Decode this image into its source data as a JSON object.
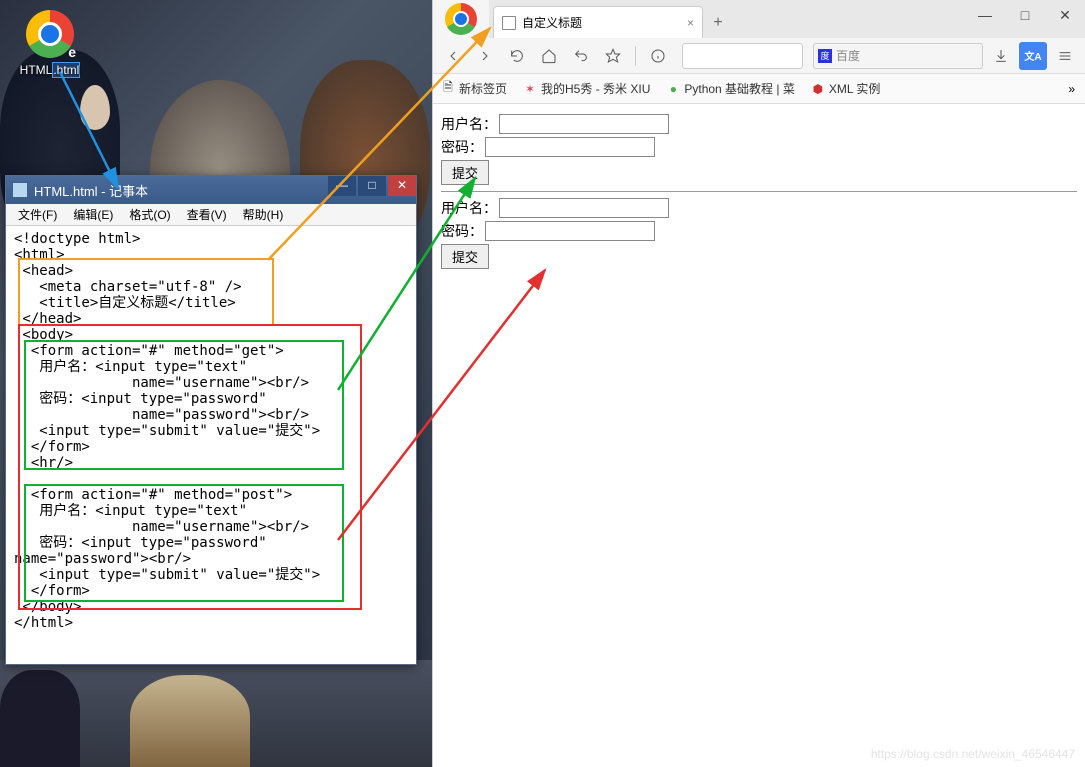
{
  "desktop": {
    "icon_label": "HTML.html",
    "icon_label_prefix": "HTML",
    "icon_label_suffix": ".html"
  },
  "notepad": {
    "title": "HTML.html - 记事本",
    "menu": [
      "文件(F)",
      "编辑(E)",
      "格式(O)",
      "查看(V)",
      "帮助(H)"
    ],
    "win_min": "—",
    "win_max": "□",
    "win_close": "✕",
    "code": "<!doctype html>\n<html>\n <head>\n   <meta charset=\"utf-8\" />\n   <title>自定义标题</title>\n </head>\n <body>\n  <form action=\"#\" method=\"get\">\n   用户名：<input type=\"text\"\n              name=\"username\"><br/>\n   密码：<input type=\"password\"\n              name=\"password\"><br/>\n   <input type=\"submit\" value=\"提交\">\n  </form>\n  <hr/>\n\n  <form action=\"#\" method=\"post\">\n   用户名：<input type=\"text\"\n              name=\"username\"><br/>\n   密码：<input type=\"password\"\nname=\"password\"><br/>\n   <input type=\"submit\" value=\"提交\">\n  </form>\n </body>\n</html>"
  },
  "browser": {
    "tab_title": "自定义标题",
    "tab_close": "×",
    "new_tab": "+",
    "win_min": "—",
    "win_max": "□",
    "win_close": "✕",
    "search_engine": "百度",
    "bookmarks": {
      "b1": "新标签页",
      "b2": "我的H5秀 - 秀米 XIU",
      "b3": "Python 基础教程 | 菜",
      "b4": "XML 实例",
      "more": "»"
    },
    "content_text": {
      "username_label": "用户名：",
      "password_label": "密码：",
      "submit_label": "提交"
    }
  },
  "watermark": "https://blog.csdn.net/weixin_46546447"
}
